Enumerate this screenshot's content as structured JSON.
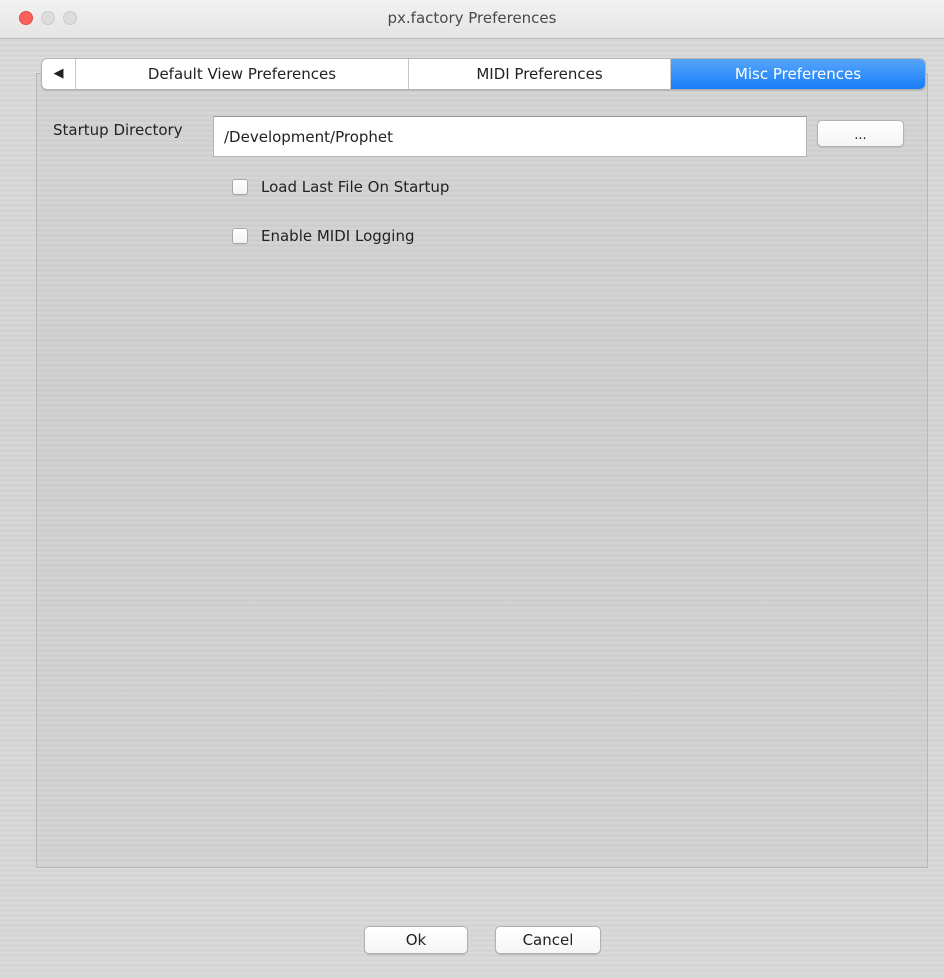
{
  "window": {
    "title": "px.factory Preferences"
  },
  "tabs": {
    "arrow": "◀",
    "items": [
      {
        "label": "Default View Preferences",
        "selected": false
      },
      {
        "label": "MIDI Preferences",
        "selected": false
      },
      {
        "label": "Misc Preferences",
        "selected": true
      }
    ]
  },
  "misc": {
    "startup_label": "Startup Directory",
    "startup_value": "/Development/Prophet",
    "browse_label": "...",
    "load_last_label": "Load Last File On Startup",
    "load_last_checked": false,
    "midi_logging_label": "Enable MIDI Logging",
    "midi_logging_checked": false
  },
  "footer": {
    "ok_label": "Ok",
    "cancel_label": "Cancel"
  },
  "colors": {
    "accent": "#1a7ef8",
    "close": "#fc605c"
  }
}
